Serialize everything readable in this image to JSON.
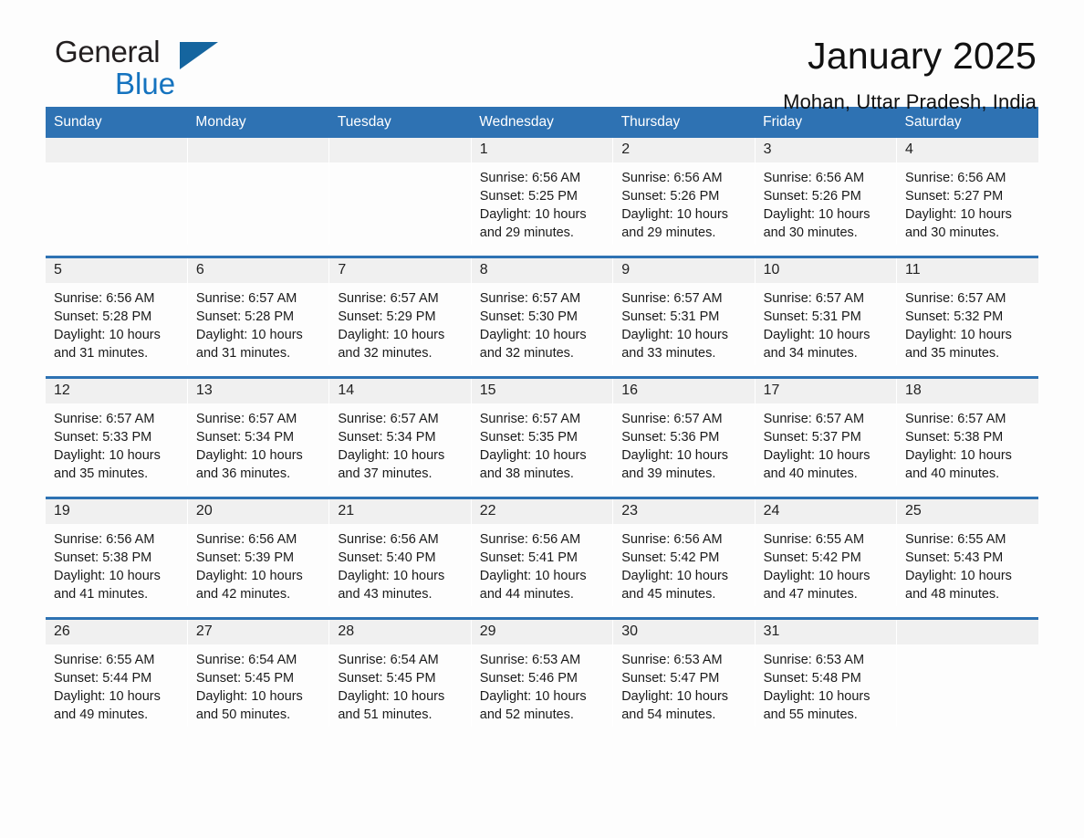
{
  "brand": {
    "name_part1": "General",
    "name_part2": "Blue",
    "triangle_color": "#15659f",
    "blue_color": "#1573bf"
  },
  "header": {
    "title": "January 2025",
    "location": "Mohan, Uttar Pradesh, India"
  },
  "theme": {
    "header_bg": "#2e72b3",
    "row_divider": "#2e72b3",
    "date_band": "#f0f0f0",
    "page_bg": "#fdfdfd"
  },
  "weekdays": [
    "Sunday",
    "Monday",
    "Tuesday",
    "Wednesday",
    "Thursday",
    "Friday",
    "Saturday"
  ],
  "weeks": [
    [
      {
        "empty": true
      },
      {
        "empty": true
      },
      {
        "empty": true
      },
      {
        "day": "1",
        "sunrise": "Sunrise: 6:56 AM",
        "sunset": "Sunset: 5:25 PM",
        "daylight": "Daylight: 10 hours and 29 minutes."
      },
      {
        "day": "2",
        "sunrise": "Sunrise: 6:56 AM",
        "sunset": "Sunset: 5:26 PM",
        "daylight": "Daylight: 10 hours and 29 minutes."
      },
      {
        "day": "3",
        "sunrise": "Sunrise: 6:56 AM",
        "sunset": "Sunset: 5:26 PM",
        "daylight": "Daylight: 10 hours and 30 minutes."
      },
      {
        "day": "4",
        "sunrise": "Sunrise: 6:56 AM",
        "sunset": "Sunset: 5:27 PM",
        "daylight": "Daylight: 10 hours and 30 minutes."
      }
    ],
    [
      {
        "day": "5",
        "sunrise": "Sunrise: 6:56 AM",
        "sunset": "Sunset: 5:28 PM",
        "daylight": "Daylight: 10 hours and 31 minutes."
      },
      {
        "day": "6",
        "sunrise": "Sunrise: 6:57 AM",
        "sunset": "Sunset: 5:28 PM",
        "daylight": "Daylight: 10 hours and 31 minutes."
      },
      {
        "day": "7",
        "sunrise": "Sunrise: 6:57 AM",
        "sunset": "Sunset: 5:29 PM",
        "daylight": "Daylight: 10 hours and 32 minutes."
      },
      {
        "day": "8",
        "sunrise": "Sunrise: 6:57 AM",
        "sunset": "Sunset: 5:30 PM",
        "daylight": "Daylight: 10 hours and 32 minutes."
      },
      {
        "day": "9",
        "sunrise": "Sunrise: 6:57 AM",
        "sunset": "Sunset: 5:31 PM",
        "daylight": "Daylight: 10 hours and 33 minutes."
      },
      {
        "day": "10",
        "sunrise": "Sunrise: 6:57 AM",
        "sunset": "Sunset: 5:31 PM",
        "daylight": "Daylight: 10 hours and 34 minutes."
      },
      {
        "day": "11",
        "sunrise": "Sunrise: 6:57 AM",
        "sunset": "Sunset: 5:32 PM",
        "daylight": "Daylight: 10 hours and 35 minutes."
      }
    ],
    [
      {
        "day": "12",
        "sunrise": "Sunrise: 6:57 AM",
        "sunset": "Sunset: 5:33 PM",
        "daylight": "Daylight: 10 hours and 35 minutes."
      },
      {
        "day": "13",
        "sunrise": "Sunrise: 6:57 AM",
        "sunset": "Sunset: 5:34 PM",
        "daylight": "Daylight: 10 hours and 36 minutes."
      },
      {
        "day": "14",
        "sunrise": "Sunrise: 6:57 AM",
        "sunset": "Sunset: 5:34 PM",
        "daylight": "Daylight: 10 hours and 37 minutes."
      },
      {
        "day": "15",
        "sunrise": "Sunrise: 6:57 AM",
        "sunset": "Sunset: 5:35 PM",
        "daylight": "Daylight: 10 hours and 38 minutes."
      },
      {
        "day": "16",
        "sunrise": "Sunrise: 6:57 AM",
        "sunset": "Sunset: 5:36 PM",
        "daylight": "Daylight: 10 hours and 39 minutes."
      },
      {
        "day": "17",
        "sunrise": "Sunrise: 6:57 AM",
        "sunset": "Sunset: 5:37 PM",
        "daylight": "Daylight: 10 hours and 40 minutes."
      },
      {
        "day": "18",
        "sunrise": "Sunrise: 6:57 AM",
        "sunset": "Sunset: 5:38 PM",
        "daylight": "Daylight: 10 hours and 40 minutes."
      }
    ],
    [
      {
        "day": "19",
        "sunrise": "Sunrise: 6:56 AM",
        "sunset": "Sunset: 5:38 PM",
        "daylight": "Daylight: 10 hours and 41 minutes."
      },
      {
        "day": "20",
        "sunrise": "Sunrise: 6:56 AM",
        "sunset": "Sunset: 5:39 PM",
        "daylight": "Daylight: 10 hours and 42 minutes."
      },
      {
        "day": "21",
        "sunrise": "Sunrise: 6:56 AM",
        "sunset": "Sunset: 5:40 PM",
        "daylight": "Daylight: 10 hours and 43 minutes."
      },
      {
        "day": "22",
        "sunrise": "Sunrise: 6:56 AM",
        "sunset": "Sunset: 5:41 PM",
        "daylight": "Daylight: 10 hours and 44 minutes."
      },
      {
        "day": "23",
        "sunrise": "Sunrise: 6:56 AM",
        "sunset": "Sunset: 5:42 PM",
        "daylight": "Daylight: 10 hours and 45 minutes."
      },
      {
        "day": "24",
        "sunrise": "Sunrise: 6:55 AM",
        "sunset": "Sunset: 5:42 PM",
        "daylight": "Daylight: 10 hours and 47 minutes."
      },
      {
        "day": "25",
        "sunrise": "Sunrise: 6:55 AM",
        "sunset": "Sunset: 5:43 PM",
        "daylight": "Daylight: 10 hours and 48 minutes."
      }
    ],
    [
      {
        "day": "26",
        "sunrise": "Sunrise: 6:55 AM",
        "sunset": "Sunset: 5:44 PM",
        "daylight": "Daylight: 10 hours and 49 minutes."
      },
      {
        "day": "27",
        "sunrise": "Sunrise: 6:54 AM",
        "sunset": "Sunset: 5:45 PM",
        "daylight": "Daylight: 10 hours and 50 minutes."
      },
      {
        "day": "28",
        "sunrise": "Sunrise: 6:54 AM",
        "sunset": "Sunset: 5:45 PM",
        "daylight": "Daylight: 10 hours and 51 minutes."
      },
      {
        "day": "29",
        "sunrise": "Sunrise: 6:53 AM",
        "sunset": "Sunset: 5:46 PM",
        "daylight": "Daylight: 10 hours and 52 minutes."
      },
      {
        "day": "30",
        "sunrise": "Sunrise: 6:53 AM",
        "sunset": "Sunset: 5:47 PM",
        "daylight": "Daylight: 10 hours and 54 minutes."
      },
      {
        "day": "31",
        "sunrise": "Sunrise: 6:53 AM",
        "sunset": "Sunset: 5:48 PM",
        "daylight": "Daylight: 10 hours and 55 minutes."
      },
      {
        "empty": true
      }
    ]
  ]
}
